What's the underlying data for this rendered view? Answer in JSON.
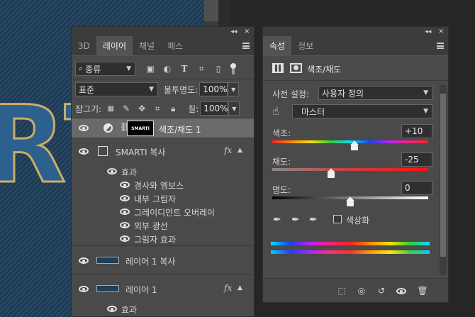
{
  "canvas": {
    "letters": "RT"
  },
  "layers_panel": {
    "tabs": [
      {
        "label": "3D",
        "active": false
      },
      {
        "label": "레이어",
        "active": true
      },
      {
        "label": "채널",
        "active": false
      },
      {
        "label": "패스",
        "active": false
      }
    ],
    "filter": {
      "label": "종류"
    },
    "blend_mode": "표준",
    "opacity_label": "불투명도:",
    "opacity_value": "100%",
    "lock_label": "잠그기:",
    "fill_label": "칠:",
    "fill_value": "100%",
    "layers": [
      {
        "name": "색조/채도 1",
        "thumb_text": "SMARTI"
      },
      {
        "name": "SMARTI 복사"
      },
      {
        "name": "레이어 1 복사"
      },
      {
        "name": "레이어 1"
      }
    ],
    "effects_label": "효과",
    "effects": [
      "경사와 엠보스",
      "내부 그림자",
      "그레이디언트 오버레이",
      "외부 광선",
      "그림자 효과"
    ],
    "effects_label2": "효과",
    "fx": "fx"
  },
  "properties_panel": {
    "tabs": [
      {
        "label": "속성",
        "active": true
      },
      {
        "label": "정보",
        "active": false
      }
    ],
    "title": "색조/채도",
    "preset_label": "사전 설정:",
    "preset_value": "사용자 정의",
    "channel_value": "마스터",
    "hue_label": "색조:",
    "hue_value": "+10",
    "hue_level": 10,
    "saturation_label": "채도:",
    "saturation_value": "-25",
    "saturation_level": -25,
    "lightness_label": "명도:",
    "lightness_value": "0",
    "lightness_level": 0,
    "colorize_label": "색상화"
  },
  "colors": {
    "panel_bg": "#4a4a4a",
    "selected_layer": "#6a6a6a",
    "canvas_blue": "#1f3f5c"
  }
}
